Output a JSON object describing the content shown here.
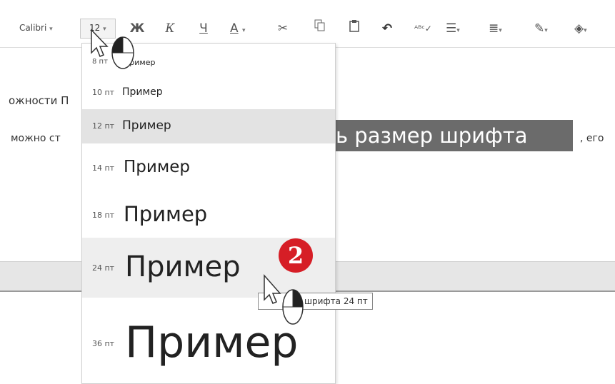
{
  "toolbar": {
    "font_name": "Calibri",
    "font_size": "12",
    "dropdown_caret": "▾",
    "bold_label": "Ж",
    "italic_label": "К",
    "underline_label": "Ч",
    "font_color_label": "А",
    "icons": [
      "cut-icon",
      "copy-icon",
      "paste-icon",
      "undo-icon",
      "spellcheck-icon",
      "list-icon",
      "indent-icon",
      "pen-icon",
      "fill-icon"
    ]
  },
  "document": {
    "line1_text": "ожности П",
    "line2_text": "можно ст",
    "selected_text": "ь размер шрифта",
    "line2_tail": ", его"
  },
  "font_size_menu": {
    "items": [
      {
        "size": "8 пт",
        "preview": "Пример"
      },
      {
        "size": "10 пт",
        "preview": "Пример"
      },
      {
        "size": "12 пт",
        "preview": "Пример"
      },
      {
        "size": "14 пт",
        "preview": "Пример"
      },
      {
        "size": "18 пт",
        "preview": "Пример"
      },
      {
        "size": "24 пт",
        "preview": "Пример"
      },
      {
        "size": "36 пт",
        "preview": "Пример"
      }
    ]
  },
  "tooltip": {
    "text": "шрифта 24 пт"
  },
  "callout": {
    "number": "2",
    "color": "#d61e26"
  }
}
